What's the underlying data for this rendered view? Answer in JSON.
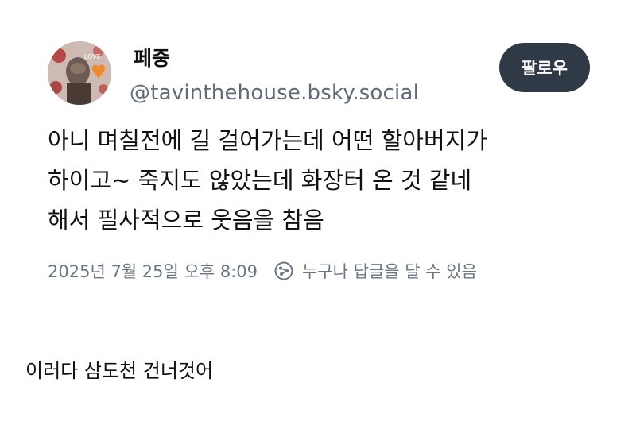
{
  "post": {
    "display_name": "페중",
    "handle": "@tavinthehouse.bsky.social",
    "follow_label": "팔로우",
    "avatar_text": "LOVE",
    "body_lines": [
      "아니 며칠전에 길 걸어가는데 어떤 할아버지가",
      "하이고~ 죽지도 않았는데 화장터 온 것 같네",
      "해서 필사적으로 웃음을 참음"
    ],
    "timestamp": "2025년 7월 25일 오후 8:09",
    "reply_setting": "누구나 답글을 달 수 있음",
    "reply_icon": "reply-permission-icon"
  },
  "caption": "이러다 삼도천 건너것어",
  "colors": {
    "follow_button_bg": "#303a47",
    "handle_text": "#5f6b7a",
    "meta_text": "#6b7685"
  }
}
